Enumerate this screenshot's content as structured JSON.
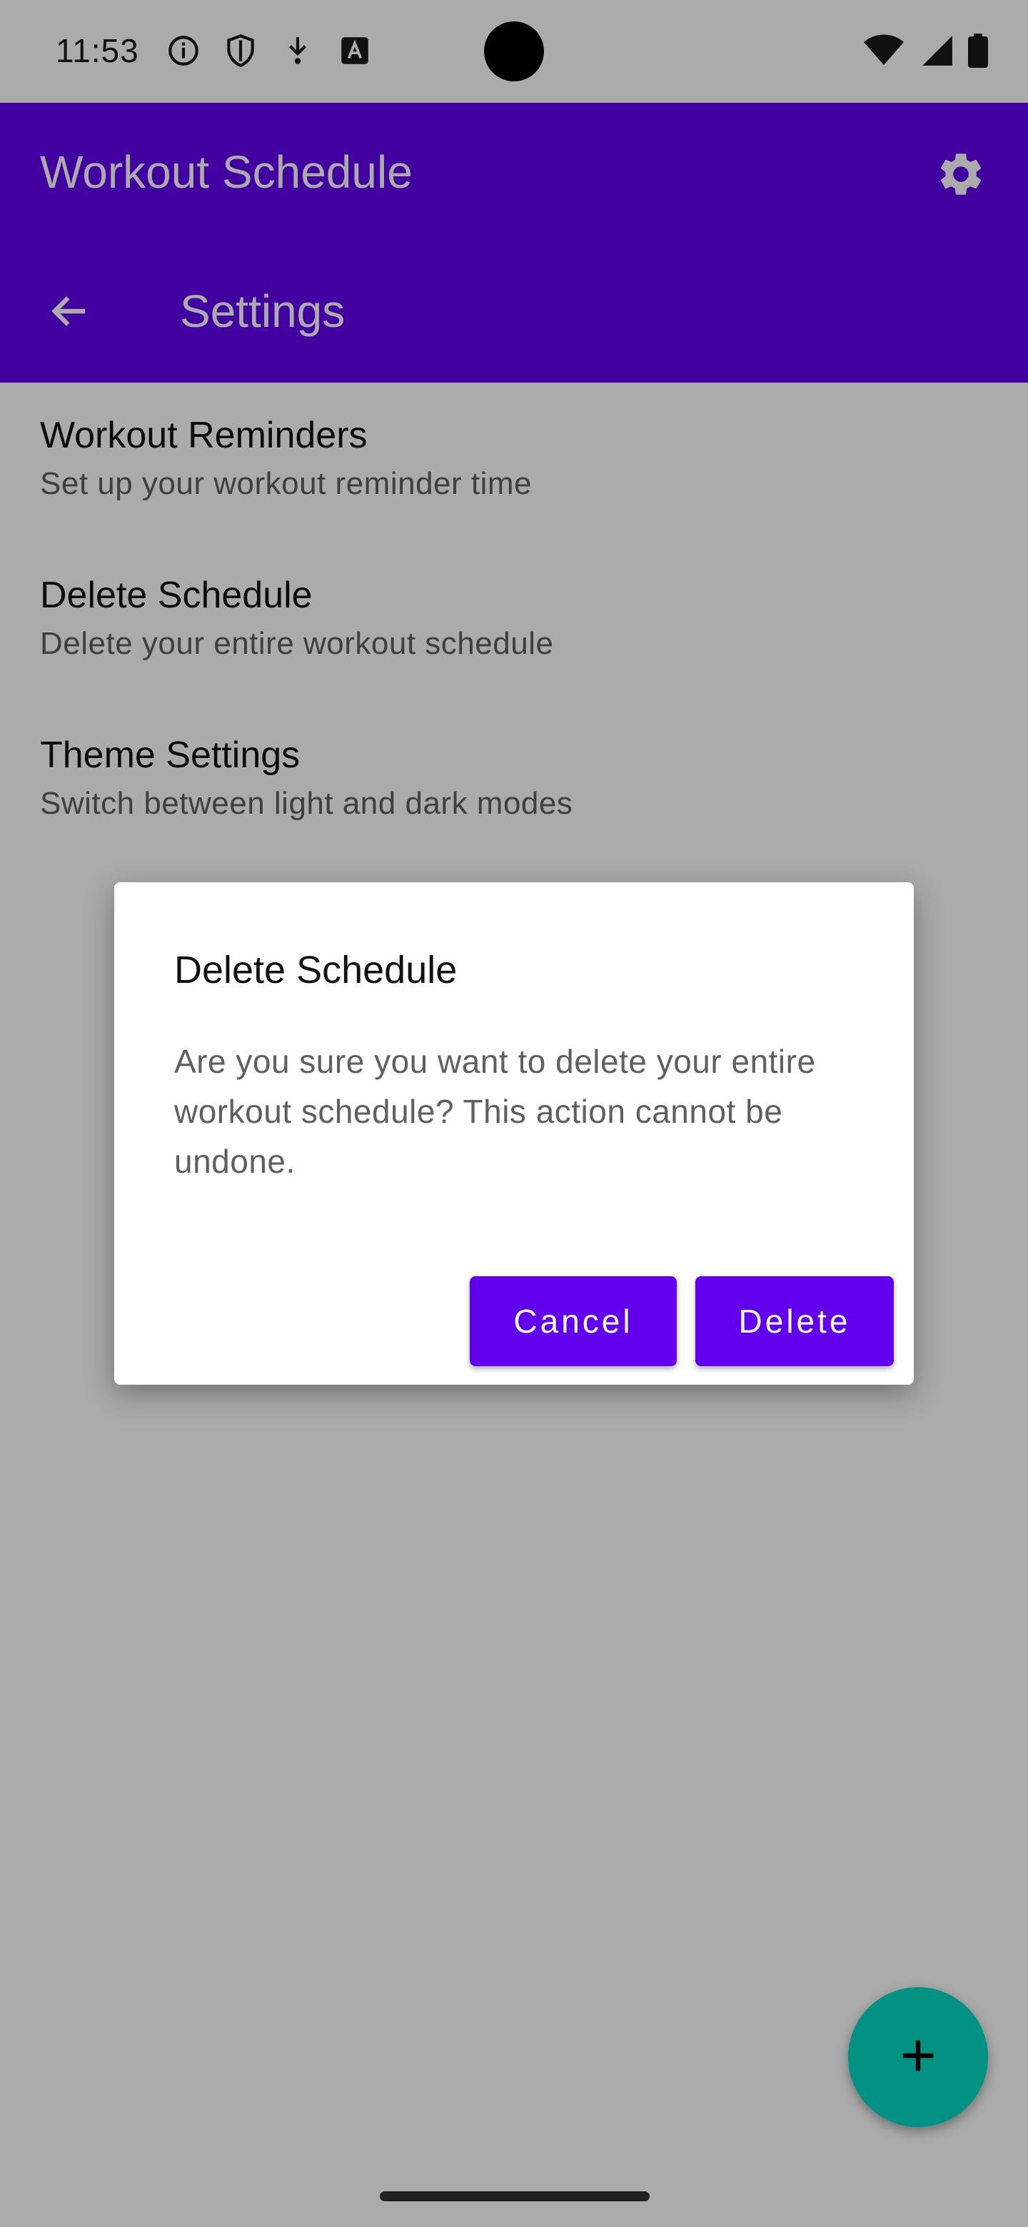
{
  "status_bar": {
    "time": "11:53",
    "left_icons": [
      "info-icon",
      "shield-icon",
      "download-icon",
      "text-icon"
    ],
    "right_icons": [
      "wifi-icon",
      "cell-signal-icon",
      "battery-icon"
    ]
  },
  "app_bar": {
    "title": "Workout Schedule",
    "action_icon": "gear-icon",
    "color": "#6200ee"
  },
  "toolbar": {
    "back_icon": "arrow-back-icon",
    "title": "Settings"
  },
  "settings": {
    "items": [
      {
        "title": "Workout Reminders",
        "subtitle": "Set up your workout reminder time"
      },
      {
        "title": "Delete Schedule",
        "subtitle": "Delete your entire workout schedule"
      },
      {
        "title": "Theme Settings",
        "subtitle": "Switch between light and dark modes"
      }
    ]
  },
  "dialog": {
    "title": "Delete Schedule",
    "message": "Are you sure you want to delete your entire workout schedule? This action cannot be undone.",
    "cancel_label": "Cancel",
    "delete_label": "Delete",
    "button_color": "#6200ee"
  },
  "fab": {
    "icon": "plus-icon",
    "color": "#03dac5"
  }
}
